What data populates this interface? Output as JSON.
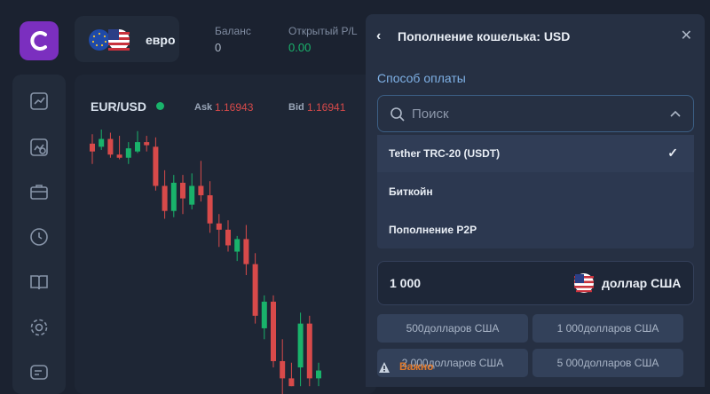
{
  "header": {
    "asset_name": "евро",
    "balance_label": "Баланс",
    "balance_value": "0",
    "pl_label": "Открытый P/L",
    "pl_value": "0.00"
  },
  "chart": {
    "pair": "EUR/USD",
    "ask_label": "Ask",
    "ask_value": "1.16943",
    "bid_label": "Bid",
    "bid_value": "1.16941"
  },
  "panel": {
    "title": "Пополнение кошелька: USD",
    "method_label": "Способ оплаты",
    "search_placeholder": "Поиск",
    "options": [
      {
        "label": "Tether TRC-20 (USDT)",
        "selected": true
      },
      {
        "label": "Биткойн",
        "selected": false
      },
      {
        "label": "Пополнение P2P",
        "selected": false
      }
    ],
    "amount_value": "1 000",
    "currency_name": "доллар США",
    "quick_amounts": [
      "500долларов США",
      "1 000долларов США",
      "2 000долларов США",
      "5 000долларов США"
    ],
    "warning": "Важно"
  },
  "sidebar": {
    "icons": [
      "chart-icon",
      "analytics-icon",
      "briefcase-icon",
      "clock-icon",
      "book-icon",
      "settings-icon",
      "support-icon"
    ]
  },
  "colors": {
    "accent_purple": "#7b2fbf",
    "up": "#19b36b",
    "down": "#d84a4a",
    "link_blue": "#7fb1e6",
    "warning": "#e37a2b"
  },
  "chart_data": {
    "type": "candlestick",
    "candles": [
      {
        "o": 1.1715,
        "h": 1.1721,
        "l": 1.1702,
        "c": 1.171
      },
      {
        "o": 1.1713,
        "h": 1.1724,
        "l": 1.1711,
        "c": 1.1718
      },
      {
        "o": 1.1718,
        "h": 1.1722,
        "l": 1.1706,
        "c": 1.1708
      },
      {
        "o": 1.1708,
        "h": 1.172,
        "l": 1.1705,
        "c": 1.1706
      },
      {
        "o": 1.1706,
        "h": 1.1716,
        "l": 1.1702,
        "c": 1.1712
      },
      {
        "o": 1.171,
        "h": 1.1723,
        "l": 1.1709,
        "c": 1.1716
      },
      {
        "o": 1.1716,
        "h": 1.172,
        "l": 1.171,
        "c": 1.1714
      },
      {
        "o": 1.1713,
        "h": 1.1719,
        "l": 1.1685,
        "c": 1.1688
      },
      {
        "o": 1.1688,
        "h": 1.1698,
        "l": 1.1667,
        "c": 1.1672
      },
      {
        "o": 1.1672,
        "h": 1.1695,
        "l": 1.1668,
        "c": 1.169
      },
      {
        "o": 1.169,
        "h": 1.1695,
        "l": 1.167,
        "c": 1.168
      },
      {
        "o": 1.1676,
        "h": 1.1696,
        "l": 1.1673,
        "c": 1.1688
      },
      {
        "o": 1.1688,
        "h": 1.1704,
        "l": 1.1678,
        "c": 1.1682
      },
      {
        "o": 1.1682,
        "h": 1.1691,
        "l": 1.1658,
        "c": 1.1664
      },
      {
        "o": 1.1664,
        "h": 1.167,
        "l": 1.1649,
        "c": 1.166
      },
      {
        "o": 1.166,
        "h": 1.1666,
        "l": 1.1646,
        "c": 1.165
      },
      {
        "o": 1.1646,
        "h": 1.1656,
        "l": 1.164,
        "c": 1.1654
      },
      {
        "o": 1.1654,
        "h": 1.1663,
        "l": 1.1631,
        "c": 1.1638
      },
      {
        "o": 1.1638,
        "h": 1.1645,
        "l": 1.16,
        "c": 1.1605
      },
      {
        "o": 1.1597,
        "h": 1.1618,
        "l": 1.159,
        "c": 1.1614
      },
      {
        "o": 1.1614,
        "h": 1.1618,
        "l": 1.1572,
        "c": 1.1576
      },
      {
        "o": 1.1576,
        "h": 1.159,
        "l": 1.1555,
        "c": 1.1565
      },
      {
        "o": 1.1565,
        "h": 1.1575,
        "l": 1.156,
        "c": 1.156
      },
      {
        "o": 1.1572,
        "h": 1.1607,
        "l": 1.156,
        "c": 1.16
      },
      {
        "o": 1.16,
        "h": 1.1605,
        "l": 1.156,
        "c": 1.1565
      },
      {
        "o": 1.1565,
        "h": 1.1575,
        "l": 1.156,
        "c": 1.157
      }
    ]
  }
}
